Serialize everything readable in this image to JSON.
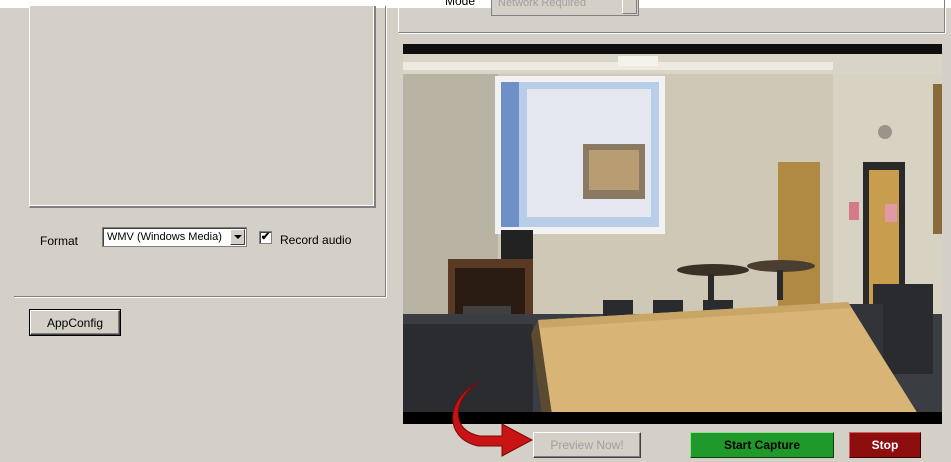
{
  "mode": {
    "label": "Mode",
    "value": "Network Required"
  },
  "format": {
    "label": "Format",
    "value": "WMV (Windows Media)"
  },
  "record_audio": {
    "label": "Record audio",
    "checked": true,
    "check_glyph": "✔"
  },
  "buttons": {
    "appconfig": "AppConfig",
    "preview_now": "Preview Now!",
    "start_capture": "Start Capture",
    "stop": "Stop"
  },
  "colors": {
    "window_bg": "#d4d0c8",
    "start_green": "#1f9a2a",
    "stop_red": "#8e0d0d",
    "arrow_red": "#c81414"
  },
  "icons": {
    "pointer_arrow": "curved-red-arrow-icon"
  }
}
